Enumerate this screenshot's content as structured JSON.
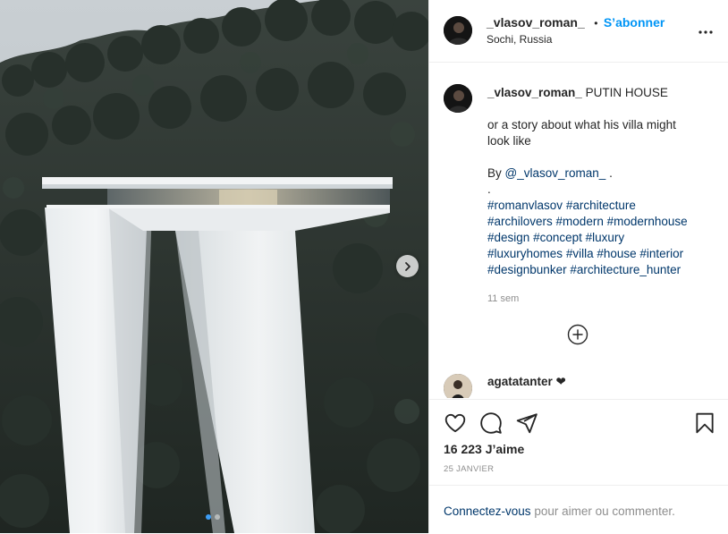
{
  "post": {
    "author": "_vlasov_roman_",
    "follow_separator": "•",
    "follow_label": "S’abonner",
    "location": "Sochi, Russia"
  },
  "caption": {
    "author": "_vlasov_roman_",
    "title": "PUTIN HOUSE",
    "line1": "or a story about what his villa might",
    "line2": "look like",
    "by_prefix": "By",
    "mention": "@_vlasov_roman_",
    "by_suffix": ".",
    "dot": ".",
    "hashtags": [
      "#romanvlasov",
      "#architecture",
      "#archilovers",
      "#modern",
      "#modernhouse",
      "#design",
      "#concept",
      "#luxury",
      "#luxuryhomes",
      "#villa",
      "#house",
      "#interior",
      "#designbunker",
      "#architecture_hunter"
    ],
    "age": "11 sem"
  },
  "comment": {
    "user": "agatatanter",
    "text": "❤"
  },
  "engagement": {
    "likes": "16 223 J’aime",
    "date": "25 JANVIER"
  },
  "login_prompt": {
    "link": "Connectez-vous",
    "rest": "pour aimer ou commenter."
  },
  "carousel": {
    "current": 1,
    "total": 2
  },
  "icons": {
    "next": "chevron-right-icon",
    "more": "more-options-icon",
    "like": "heart-icon",
    "comment": "comment-icon",
    "share": "share-icon",
    "save": "bookmark-icon",
    "load_more": "plus-circle-icon"
  },
  "colors": {
    "accent": "#0095f6",
    "link": "#00376b",
    "muted": "#8e8e8e",
    "text": "#262626"
  }
}
